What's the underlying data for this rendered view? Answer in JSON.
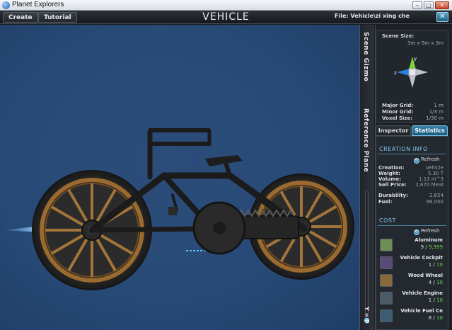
{
  "window": {
    "title": "Planet Explorers",
    "min": "–",
    "max": "□",
    "close": "✕"
  },
  "menubar": {
    "create": "Create",
    "tutorial": "Tutorial",
    "mode_title": "VEHICLE",
    "file_label": "File: Vehicle\\zi xing che",
    "exit": "✕"
  },
  "side_strip": {
    "scene_gizmo": "Scene Gizmo",
    "reference_plane": "Reference Plane",
    "y_value": "Y = 0"
  },
  "scene": {
    "size_label": "Scene Size:",
    "size_value": "3m x 5m x 3m",
    "axis_y": "y",
    "axis_z": "z",
    "major_grid_label": "Major Grid:",
    "major_grid_value": "1 m",
    "minor_grid_label": "Minor Grid:",
    "minor_grid_value": "1/3 m",
    "voxel_size_label": "Voxel Size:",
    "voxel_size_value": "1/30 m"
  },
  "tabs": {
    "inspector": "Inspector",
    "statistics": "Statistics"
  },
  "creation_info": {
    "header": "CREATION INFO",
    "refresh": "Refresh",
    "rows": [
      {
        "label": "Creation:",
        "value": "Vehicle"
      },
      {
        "label": "Weight:",
        "value": "5.30 T"
      },
      {
        "label": "Volume:",
        "value": "1.13 m^3"
      },
      {
        "label": "Sell Price:",
        "value": "2,670 Meat"
      }
    ],
    "durability_label": "Durability:",
    "durability_value": "2,654",
    "fuel_label": "Fuel:",
    "fuel_value": "96,000"
  },
  "cost": {
    "header": "COST",
    "refresh": "Refresh",
    "items": [
      {
        "name": "Aluminum",
        "have": "9",
        "need": "9,999",
        "icon": "aluminum-icon",
        "color": "#6f8f55"
      },
      {
        "name": "Vehicle Cockpit",
        "have": "1",
        "need": "10",
        "icon": "vehicle-cockpit-icon",
        "color": "#5a4a7a"
      },
      {
        "name": "Wood Wheel",
        "have": "4",
        "need": "10",
        "icon": "wood-wheel-icon",
        "color": "#8a6a3a"
      },
      {
        "name": "Vehicle Engine",
        "have": "1",
        "need": "10",
        "icon": "vehicle-engine-icon",
        "color": "#4a5a66"
      },
      {
        "name": "Vehicle Fuel Ce",
        "have": "8",
        "need": "10",
        "icon": "vehicle-fuel-cell-icon",
        "color": "#3d5e72"
      }
    ]
  },
  "colors": {
    "viewport_bg": "#284a77",
    "accent": "#3a82a8",
    "ok_green": "#6fd34a",
    "wheel_rim": "#9a6a2e"
  }
}
